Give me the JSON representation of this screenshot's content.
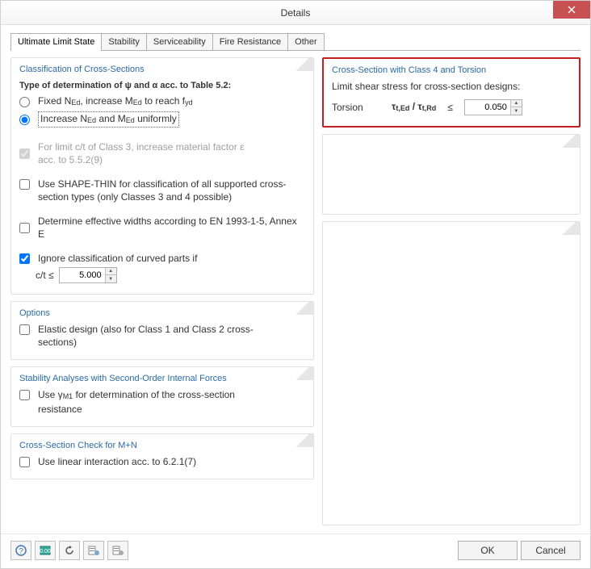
{
  "window": {
    "title": "Details"
  },
  "tabs": [
    {
      "label": "Ultimate Limit State",
      "active": true
    },
    {
      "label": "Stability"
    },
    {
      "label": "Serviceability"
    },
    {
      "label": "Fire Resistance"
    },
    {
      "label": "Other"
    }
  ],
  "groups": {
    "classification": {
      "title": "Classification of Cross-Sections",
      "type_heading": "Type of determination of ψ and α acc. to Table 5.2:",
      "radio1": "Fixed NEd, increase MEd to reach fyd",
      "radio2": "Increase NEd and MEd uniformly",
      "chk_material": "For limit c/t of Class 3, increase material factor ε acc. to 5.5.2(9)",
      "chk_shapethin": "Use SHAPE-THIN for classification of all supported cross-section types (only Classes 3 and 4 possible)",
      "chk_effwidth": "Determine effective widths according to EN 1993-1-5, Annex E",
      "chk_ignore": "Ignore classification of curved parts if",
      "ct_label": "c/t ≤",
      "ct_value": "5.000"
    },
    "options": {
      "title": "Options",
      "chk_elastic": "Elastic design (also for Class 1 and Class 2 cross-sections)"
    },
    "stability": {
      "title": "Stability Analyses with Second-Order Internal Forces",
      "chk_gamma": "Use γM1 for determination of the cross-section resistance"
    },
    "mn": {
      "title": "Cross-Section Check for M+N",
      "chk_linear": "Use linear interaction acc. to 6.2.1(7)"
    },
    "torsion": {
      "title": "Cross-Section with Class 4 and Torsion",
      "subtitle": "Limit shear stress for cross-section designs:",
      "row_label": "Torsion",
      "formula": "τt,Ed / τt,Rd",
      "op": "≤",
      "value": "0.050"
    }
  },
  "footer": {
    "ok": "OK",
    "cancel": "Cancel"
  }
}
